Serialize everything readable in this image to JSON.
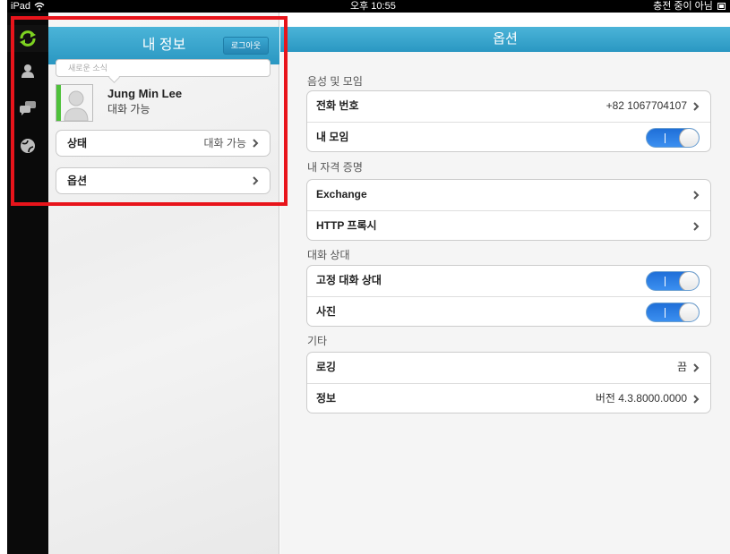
{
  "status_bar": {
    "carrier": "iPad",
    "time": "오후 10:55",
    "battery": "충전 중이 아님"
  },
  "left": {
    "header_title": "내 정보",
    "logout_label": "로그아웃",
    "news_placeholder": "새로운 소식",
    "profile": {
      "name": "Jung Min Lee",
      "status": "대화 가능"
    },
    "status_button": {
      "label": "상태",
      "value": "대화 가능"
    },
    "options_button": {
      "label": "옵션"
    }
  },
  "right": {
    "header_title": "옵션",
    "sections": [
      {
        "title": "음성 및 모임",
        "rows": [
          {
            "label": "전화 번호",
            "value": "+82 1067704107",
            "type": "chevron"
          },
          {
            "label": "내 모임",
            "type": "toggle",
            "on": true
          }
        ]
      },
      {
        "title": "내 자격 증명",
        "rows": [
          {
            "label": "Exchange",
            "type": "chevron"
          },
          {
            "label": "HTTP 프록시",
            "type": "chevron"
          }
        ]
      },
      {
        "title": "대화 상대",
        "rows": [
          {
            "label": "고정 대화 상대",
            "type": "toggle",
            "on": true
          },
          {
            "label": "사진",
            "type": "toggle",
            "on": true
          }
        ]
      },
      {
        "title": "기타",
        "rows": [
          {
            "label": "로깅",
            "value": "끔",
            "type": "chevron"
          },
          {
            "label": "정보",
            "value": "버전 4.3.8000.0000",
            "type": "chevron"
          }
        ]
      }
    ]
  },
  "colors": {
    "header_blue": "#3aa6cf",
    "toggle_on": "#2a7fe6",
    "presence_green": "#4ec13a",
    "highlight_red": "#e8141b"
  },
  "icons": [
    "sync-icon",
    "contact-icon",
    "chat-icon",
    "globe-icon",
    "chevron-right-icon",
    "wifi-icon",
    "battery-icon"
  ]
}
